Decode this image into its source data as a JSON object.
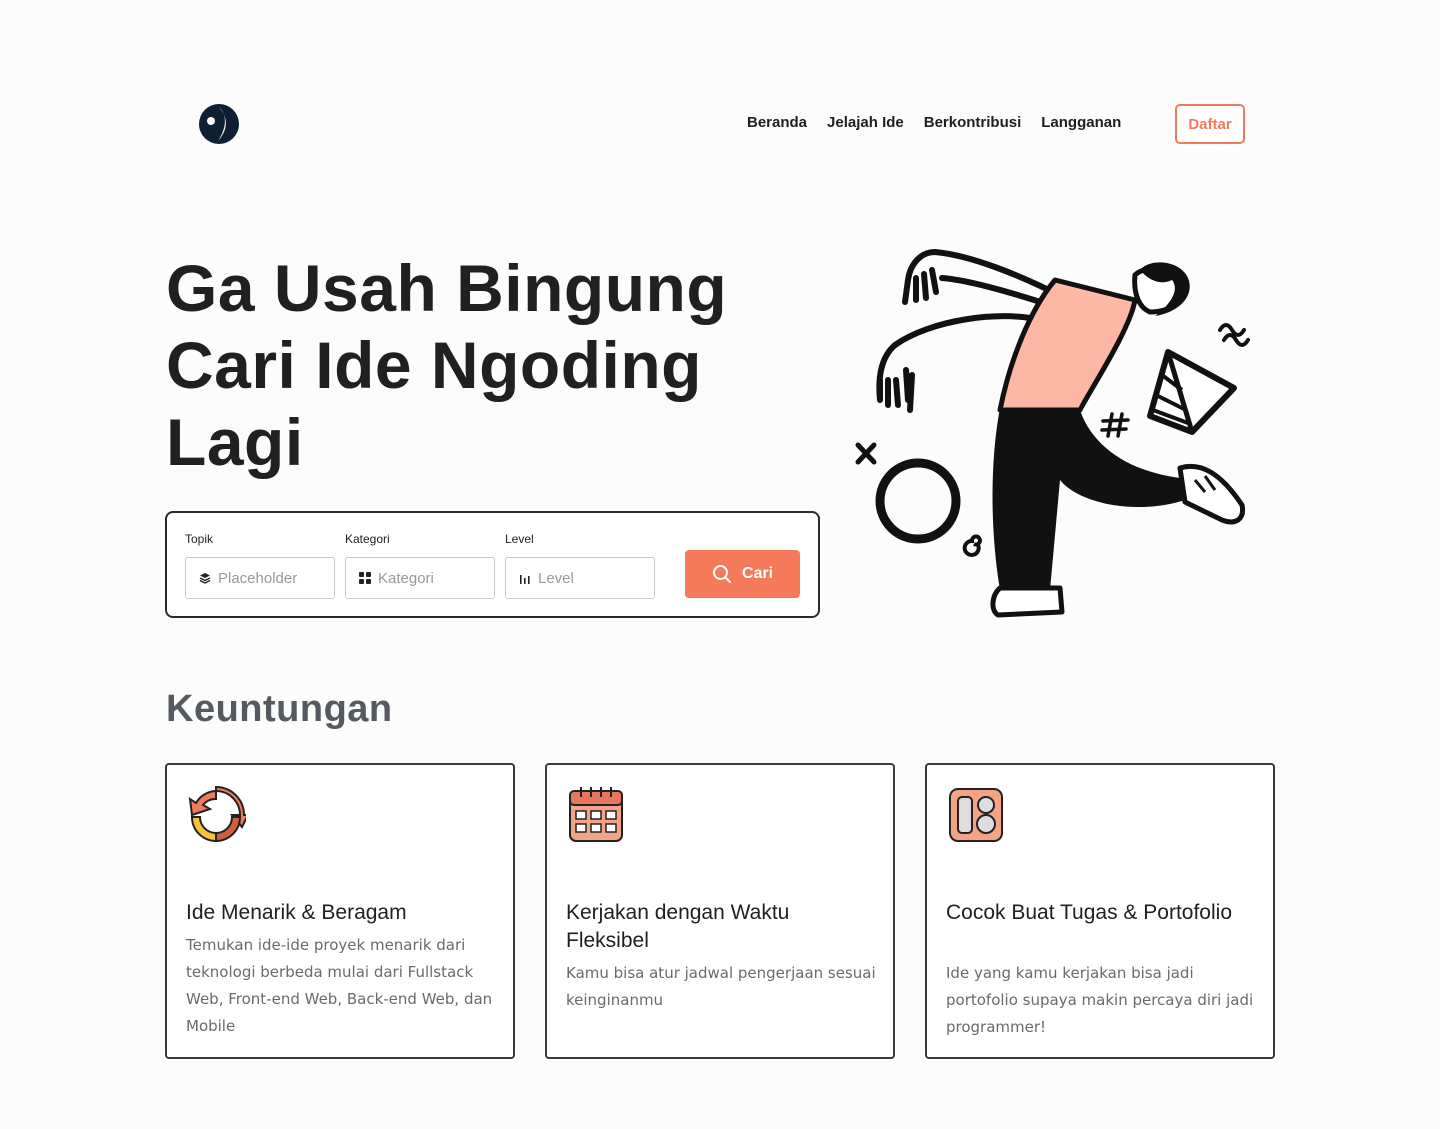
{
  "nav": {
    "items": [
      "Beranda",
      "Jelajah Ide",
      "Berkontribusi",
      "Langganan"
    ],
    "cta": "Daftar"
  },
  "hero": {
    "title": "Ga Usah Bingung Cari Ide Ngoding Lagi"
  },
  "search": {
    "topik": {
      "label": "Topik",
      "placeholder": "Placeholder",
      "icon": "layers-icon"
    },
    "kategori": {
      "label": "Kategori",
      "placeholder": "Kategori",
      "icon": "grid-icon"
    },
    "level": {
      "label": "Level",
      "placeholder": "Level",
      "icon": "bar-chart-icon"
    },
    "button": "Cari"
  },
  "benefits": {
    "title": "Keuntungan",
    "cards": [
      {
        "title": "Ide Menarik & Beragam",
        "desc": "Temukan ide-ide proyek menarik dari teknologi berbeda mulai dari Fullstack Web, Front-end Web, Back-end Web, dan Mobile",
        "icon": "refresh-cycle-icon"
      },
      {
        "title": "Kerjakan dengan Waktu Fleksibel",
        "desc": "Kamu bisa atur jadwal pengerjaan sesuai keinginanmu",
        "icon": "calendar-icon"
      },
      {
        "title": "Cocok Buat Tugas & Portofolio",
        "desc": "Ide yang kamu kerjakan bisa jadi portofolio supaya makin percaya diri jadi programmer!",
        "icon": "portfolio-layout-icon"
      }
    ]
  },
  "colors": {
    "accent": "#f47a5a",
    "dark": "#1f1f1f",
    "skin": "#fcb8a4"
  }
}
